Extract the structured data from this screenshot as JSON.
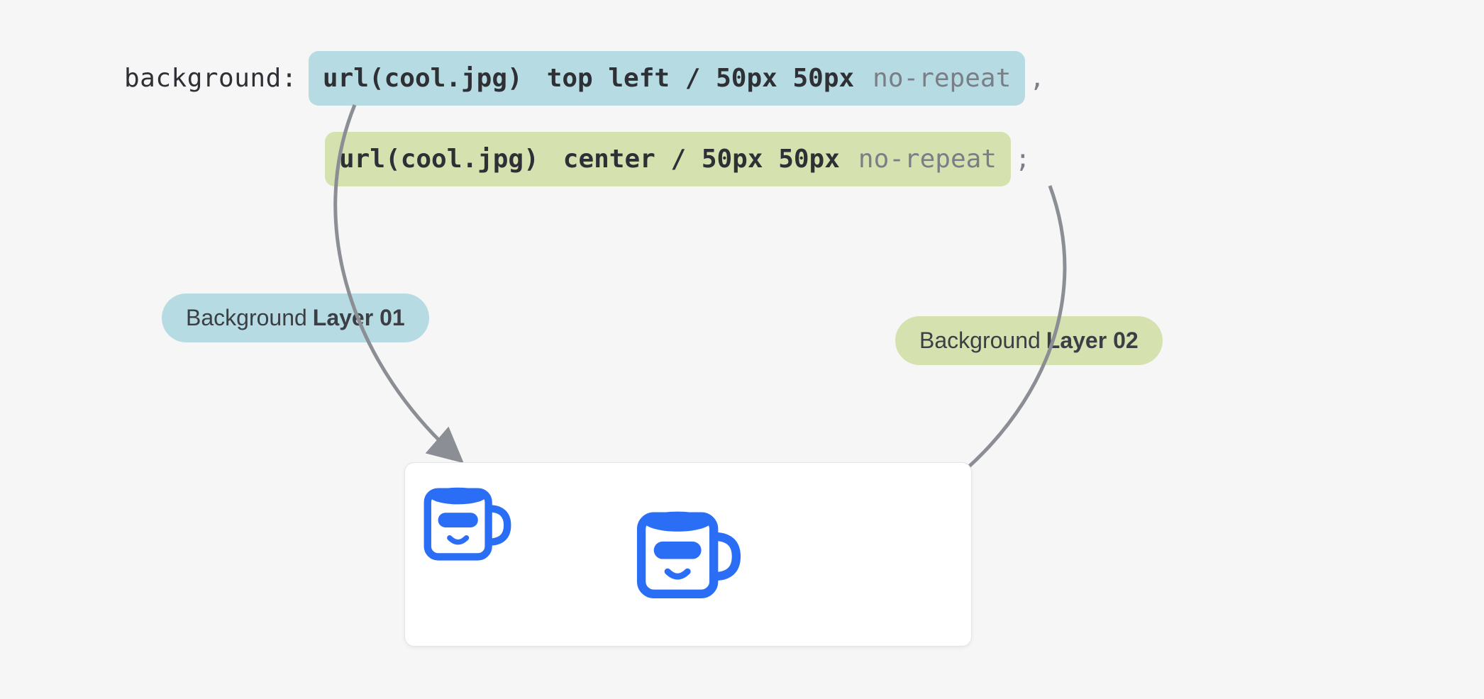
{
  "code": {
    "property": "background:",
    "line1": {
      "url": "url(cool.jpg)",
      "position": "top left / 50px 50px",
      "repeat": "no-repeat",
      "trailing": ","
    },
    "line2": {
      "url": "url(cool.jpg)",
      "position": "center / 50px 50px",
      "repeat": "no-repeat",
      "trailing": ";"
    }
  },
  "labels": {
    "layer1_prefix": "Background",
    "layer1_bold": "Layer 01",
    "layer2_prefix": "Background",
    "layer2_bold": "Layer 02"
  },
  "colors": {
    "blue_highlight": "#b6dbe2",
    "green_highlight": "#d5e2af",
    "mug_blue": "#2a6ef6"
  }
}
